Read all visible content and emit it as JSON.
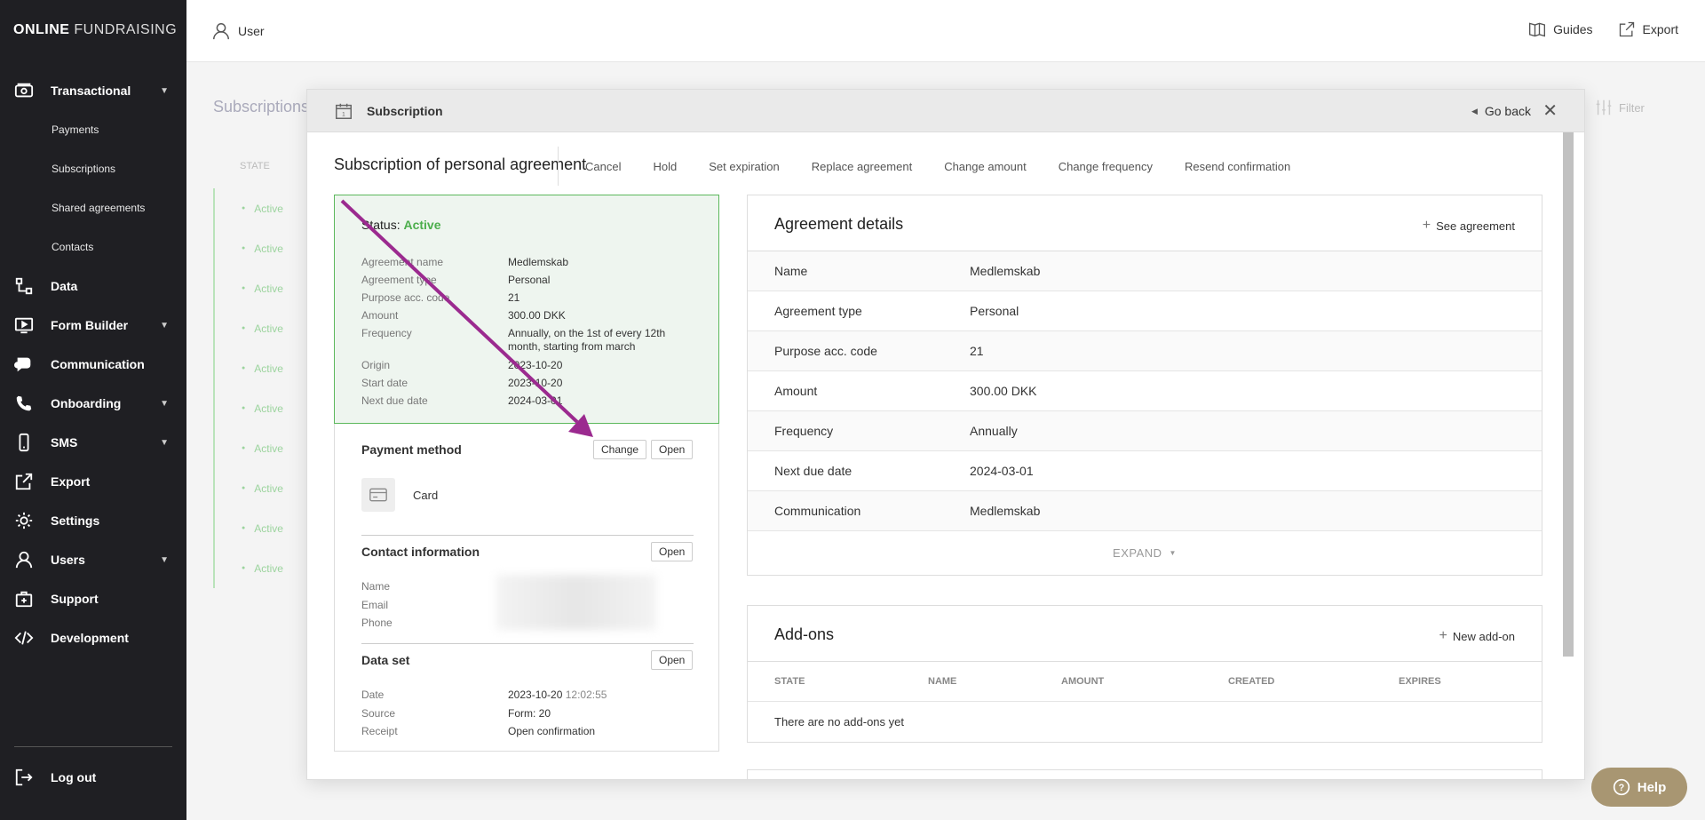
{
  "brand": {
    "bold": "ONLINE",
    "light": "FUNDRAISING"
  },
  "sidebar": {
    "items": [
      {
        "label": "Transactional",
        "icon": "money-icon",
        "has_caret": true
      },
      {
        "label": "Payments",
        "sub": true
      },
      {
        "label": "Subscriptions",
        "sub": true
      },
      {
        "label": "Shared agreements",
        "sub": true
      },
      {
        "label": "Contacts",
        "sub": true
      },
      {
        "label": "Data",
        "icon": "data-icon"
      },
      {
        "label": "Form Builder",
        "icon": "form-icon",
        "has_caret": true
      },
      {
        "label": "Communication",
        "icon": "chat-icon"
      },
      {
        "label": "Onboarding",
        "icon": "phone-icon",
        "has_caret": true
      },
      {
        "label": "SMS",
        "icon": "mobile-icon",
        "has_caret": true
      },
      {
        "label": "Export",
        "icon": "export-icon"
      },
      {
        "label": "Settings",
        "icon": "gear-icon"
      },
      {
        "label": "Users",
        "icon": "user-icon",
        "has_caret": true
      },
      {
        "label": "Support",
        "icon": "support-icon"
      },
      {
        "label": "Development",
        "icon": "code-icon"
      }
    ],
    "logout": "Log out"
  },
  "topbar": {
    "user": "User",
    "guides": "Guides",
    "export": "Export"
  },
  "background": {
    "title": "Subscriptions",
    "filter": "Filter",
    "state_header": "STATE",
    "rows": [
      "Active",
      "Active",
      "Active",
      "Active",
      "Active",
      "Active",
      "Active",
      "Active",
      "Active",
      "Active"
    ]
  },
  "modal": {
    "title": "Subscription",
    "go_back": "Go back",
    "heading": "Subscription of personal agreement",
    "actions": [
      "Cancel",
      "Hold",
      "Set expiration",
      "Replace agreement",
      "Change amount",
      "Change frequency",
      "Resend confirmation"
    ],
    "status": {
      "label": "Status:",
      "value": "Active"
    },
    "summary": [
      {
        "k": "Agreement name",
        "v": "Medlemskab"
      },
      {
        "k": "Agreement type",
        "v": "Personal"
      },
      {
        "k": "Purpose acc. code",
        "v": "21"
      },
      {
        "k": "Amount",
        "v": "300.00 DKK"
      },
      {
        "k": "Frequency",
        "v": "Annually, on the 1st of every 12th month, starting from march"
      },
      {
        "k": "Origin",
        "v": "2023-10-20"
      },
      {
        "k": "Start date",
        "v": "2023-10-20"
      },
      {
        "k": "Next due date",
        "v": "2024-03-01"
      }
    ],
    "payment_method": {
      "title": "Payment method",
      "change": "Change",
      "open": "Open",
      "card": "Card"
    },
    "contact": {
      "title": "Contact information",
      "open": "Open",
      "fields": [
        "Name",
        "Email",
        "Phone"
      ]
    },
    "dataset": {
      "title": "Data set",
      "open": "Open",
      "date_label": "Date",
      "date": "2023-10-20",
      "time": "12:02:55",
      "source_label": "Source",
      "source": "Form: 20",
      "receipt_label": "Receipt",
      "receipt": "Open confirmation"
    },
    "agreement": {
      "title": "Agreement details",
      "action": "See agreement",
      "rows": [
        {
          "k": "Name",
          "v": "Medlemskab"
        },
        {
          "k": "Agreement type",
          "v": "Personal"
        },
        {
          "k": "Purpose acc. code",
          "v": "21"
        },
        {
          "k": "Amount",
          "v": "300.00 DKK"
        },
        {
          "k": "Frequency",
          "v": "Annually"
        },
        {
          "k": "Next due date",
          "v": "2024-03-01"
        },
        {
          "k": "Communication",
          "v": "Medlemskab"
        }
      ],
      "expand": "EXPAND"
    },
    "addons": {
      "title": "Add-ons",
      "action": "New add-on",
      "headers": [
        "STATE",
        "NAME",
        "AMOUNT",
        "CREATED",
        "EXPIRES"
      ],
      "empty": "There are no add-ons yet"
    }
  },
  "help": "Help",
  "colors": {
    "sidebar_bg": "#1f1f23",
    "active_green": "#4cae4c",
    "status_border": "#5cb85c",
    "gold_link": "#b08a4a",
    "arrow": "#9b2a8f",
    "help_bg": "#a89672"
  }
}
